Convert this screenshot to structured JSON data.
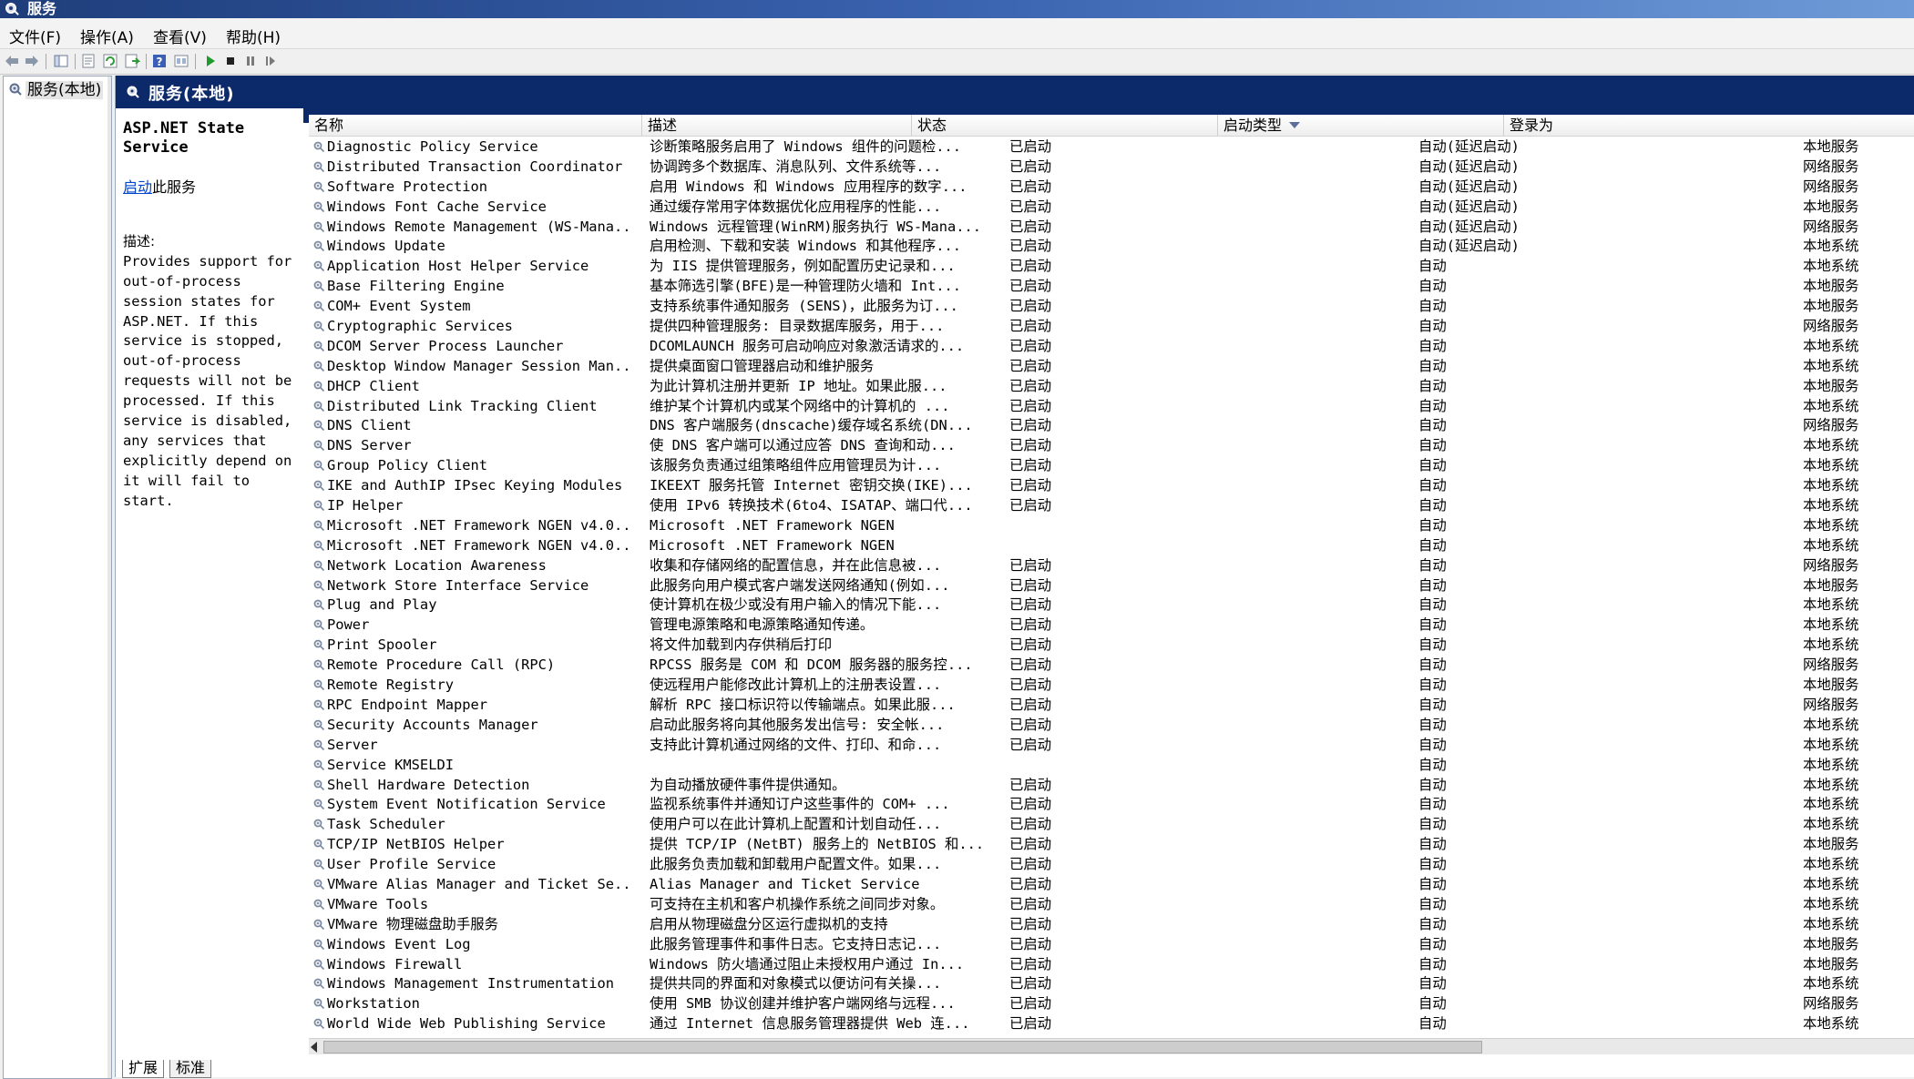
{
  "window": {
    "title": "服务",
    "icon": "gear-icon"
  },
  "menu": [
    "文件(F)",
    "操作(A)",
    "查看(V)",
    "帮助(H)"
  ],
  "toolbar": {
    "buttons": [
      "back-icon",
      "forward-icon",
      "show-hide-tree-icon",
      "properties-icon",
      "refresh-icon",
      "export-list-icon",
      "help-icon",
      "view-icon",
      "start-service-icon",
      "stop-service-icon",
      "pause-service-icon",
      "restart-service-icon"
    ]
  },
  "tree": {
    "root_label": "服务(本地)"
  },
  "pane": {
    "title": "服务(本地)"
  },
  "details": {
    "service_name": "ASP.NET State\nService",
    "action_link": "启动",
    "action_suffix": "此服务",
    "description_label": "描述:",
    "description_text": "Provides support for\nout-of-process\nsession states for\nASP.NET. If this\nservice is stopped,\nout-of-process\nrequests will not be\nprocessed. If this\nservice is disabled,\nany services that\nexplicitly depend on\nit will fail to start."
  },
  "columns": {
    "name": "名称",
    "description": "描述",
    "status": "状态",
    "startup_type": "启动类型",
    "logon_as": "登录为"
  },
  "services": [
    {
      "name": "Diagnostic Policy Service",
      "desc": "诊断策略服务启用了 Windows 组件的问题检...",
      "status": "已启动",
      "startup": "自动(延迟启动)",
      "logon": "本地服务"
    },
    {
      "name": "Distributed Transaction Coordinator",
      "desc": "协调跨多个数据库、消息队列、文件系统等...",
      "status": "已启动",
      "startup": "自动(延迟启动)",
      "logon": "网络服务"
    },
    {
      "name": "Software Protection",
      "desc": "启用 Windows 和 Windows 应用程序的数字...",
      "status": "已启动",
      "startup": "自动(延迟启动)",
      "logon": "网络服务"
    },
    {
      "name": "Windows Font Cache Service",
      "desc": "通过缓存常用字体数据优化应用程序的性能...",
      "status": "已启动",
      "startup": "自动(延迟启动)",
      "logon": "本地服务"
    },
    {
      "name": "Windows Remote Management (WS-Mana...",
      "desc": "Windows 远程管理(WinRM)服务执行 WS-Mana...",
      "status": "已启动",
      "startup": "自动(延迟启动)",
      "logon": "网络服务"
    },
    {
      "name": "Windows Update",
      "desc": "启用检测、下载和安装 Windows 和其他程序...",
      "status": "已启动",
      "startup": "自动(延迟启动)",
      "logon": "本地系统"
    },
    {
      "name": "Application Host Helper Service",
      "desc": "为 IIS 提供管理服务，例如配置历史记录和...",
      "status": "已启动",
      "startup": "自动",
      "logon": "本地系统"
    },
    {
      "name": "Base Filtering Engine",
      "desc": "基本筛选引擎(BFE)是一种管理防火墙和 Int...",
      "status": "已启动",
      "startup": "自动",
      "logon": "本地服务"
    },
    {
      "name": "COM+ Event System",
      "desc": "支持系统事件通知服务 (SENS)，此服务为订...",
      "status": "已启动",
      "startup": "自动",
      "logon": "本地服务"
    },
    {
      "name": "Cryptographic Services",
      "desc": "提供四种管理服务: 目录数据库服务，用于...",
      "status": "已启动",
      "startup": "自动",
      "logon": "网络服务"
    },
    {
      "name": "DCOM Server Process Launcher",
      "desc": "DCOMLAUNCH 服务可启动响应对象激活请求的...",
      "status": "已启动",
      "startup": "自动",
      "logon": "本地系统"
    },
    {
      "name": "Desktop Window Manager Session Man...",
      "desc": "提供桌面窗口管理器启动和维护服务",
      "status": "已启动",
      "startup": "自动",
      "logon": "本地系统"
    },
    {
      "name": "DHCP Client",
      "desc": "为此计算机注册并更新 IP 地址。如果此服...",
      "status": "已启动",
      "startup": "自动",
      "logon": "本地服务"
    },
    {
      "name": "Distributed Link Tracking Client",
      "desc": "维护某个计算机内或某个网络中的计算机的 ...",
      "status": "已启动",
      "startup": "自动",
      "logon": "本地系统"
    },
    {
      "name": "DNS Client",
      "desc": "DNS 客户端服务(dnscache)缓存域名系统(DN...",
      "status": "已启动",
      "startup": "自动",
      "logon": "网络服务"
    },
    {
      "name": "DNS Server",
      "desc": "使 DNS 客户端可以通过应答 DNS 查询和动...",
      "status": "已启动",
      "startup": "自动",
      "logon": "本地系统"
    },
    {
      "name": "Group Policy Client",
      "desc": "该服务负责通过组策略组件应用管理员为计...",
      "status": "已启动",
      "startup": "自动",
      "logon": "本地系统"
    },
    {
      "name": "IKE and AuthIP IPsec Keying Modules",
      "desc": "IKEEXT 服务托管 Internet 密钥交换(IKE)...",
      "status": "已启动",
      "startup": "自动",
      "logon": "本地系统"
    },
    {
      "name": "IP Helper",
      "desc": "使用 IPv6 转换技术(6to4、ISATAP、端口代...",
      "status": "已启动",
      "startup": "自动",
      "logon": "本地系统"
    },
    {
      "name": "Microsoft .NET Framework NGEN v4.0...",
      "desc": "Microsoft .NET Framework NGEN",
      "status": "",
      "startup": "自动",
      "logon": "本地系统"
    },
    {
      "name": "Microsoft .NET Framework NGEN v4.0...",
      "desc": "Microsoft .NET Framework NGEN",
      "status": "",
      "startup": "自动",
      "logon": "本地系统"
    },
    {
      "name": "Network Location Awareness",
      "desc": "收集和存储网络的配置信息，并在此信息被...",
      "status": "已启动",
      "startup": "自动",
      "logon": "网络服务"
    },
    {
      "name": "Network Store Interface Service",
      "desc": "此服务向用户模式客户端发送网络通知(例如...",
      "status": "已启动",
      "startup": "自动",
      "logon": "本地服务"
    },
    {
      "name": "Plug and Play",
      "desc": "使计算机在极少或没有用户输入的情况下能...",
      "status": "已启动",
      "startup": "自动",
      "logon": "本地系统"
    },
    {
      "name": "Power",
      "desc": "管理电源策略和电源策略通知传递。",
      "status": "已启动",
      "startup": "自动",
      "logon": "本地系统"
    },
    {
      "name": "Print Spooler",
      "desc": "将文件加载到内存供稍后打印",
      "status": "已启动",
      "startup": "自动",
      "logon": "本地系统"
    },
    {
      "name": "Remote Procedure Call (RPC)",
      "desc": "RPCSS 服务是 COM 和 DCOM 服务器的服务控...",
      "status": "已启动",
      "startup": "自动",
      "logon": "网络服务"
    },
    {
      "name": "Remote Registry",
      "desc": "使远程用户能修改此计算机上的注册表设置...",
      "status": "已启动",
      "startup": "自动",
      "logon": "本地服务"
    },
    {
      "name": "RPC Endpoint Mapper",
      "desc": "解析 RPC 接口标识符以传输端点。如果此服...",
      "status": "已启动",
      "startup": "自动",
      "logon": "网络服务"
    },
    {
      "name": "Security Accounts Manager",
      "desc": "启动此服务将向其他服务发出信号: 安全帐...",
      "status": "已启动",
      "startup": "自动",
      "logon": "本地系统"
    },
    {
      "name": "Server",
      "desc": "支持此计算机通过网络的文件、打印、和命...",
      "status": "已启动",
      "startup": "自动",
      "logon": "本地系统"
    },
    {
      "name": "Service KMSELDI",
      "desc": "",
      "status": "",
      "startup": "自动",
      "logon": "本地系统"
    },
    {
      "name": "Shell Hardware Detection",
      "desc": "为自动播放硬件事件提供通知。",
      "status": "已启动",
      "startup": "自动",
      "logon": "本地系统"
    },
    {
      "name": "System Event Notification Service",
      "desc": "监视系统事件并通知订户这些事件的 COM+ ...",
      "status": "已启动",
      "startup": "自动",
      "logon": "本地系统"
    },
    {
      "name": "Task Scheduler",
      "desc": "使用户可以在此计算机上配置和计划自动任...",
      "status": "已启动",
      "startup": "自动",
      "logon": "本地系统"
    },
    {
      "name": "TCP/IP NetBIOS Helper",
      "desc": "提供 TCP/IP (NetBT) 服务上的 NetBIOS 和...",
      "status": "已启动",
      "startup": "自动",
      "logon": "本地服务"
    },
    {
      "name": "User Profile Service",
      "desc": "此服务负责加载和卸载用户配置文件。如果...",
      "status": "已启动",
      "startup": "自动",
      "logon": "本地系统"
    },
    {
      "name": "VMware Alias Manager and Ticket Se...",
      "desc": "Alias Manager and Ticket Service",
      "status": "已启动",
      "startup": "自动",
      "logon": "本地系统"
    },
    {
      "name": "VMware Tools",
      "desc": "可支持在主机和客户机操作系统之间同步对象。",
      "status": "已启动",
      "startup": "自动",
      "logon": "本地系统"
    },
    {
      "name": "VMware 物理磁盘助手服务",
      "desc": "启用从物理磁盘分区运行虚拟机的支持",
      "status": "已启动",
      "startup": "自动",
      "logon": "本地系统"
    },
    {
      "name": "Windows Event Log",
      "desc": "此服务管理事件和事件日志。它支持日志记...",
      "status": "已启动",
      "startup": "自动",
      "logon": "本地服务"
    },
    {
      "name": "Windows Firewall",
      "desc": "Windows 防火墙通过阻止未授权用户通过 In...",
      "status": "已启动",
      "startup": "自动",
      "logon": "本地服务"
    },
    {
      "name": "Windows Management Instrumentation",
      "desc": "提供共同的界面和对象模式以便访问有关操...",
      "status": "已启动",
      "startup": "自动",
      "logon": "本地系统"
    },
    {
      "name": "Workstation",
      "desc": "使用 SMB 协议创建并维护客户端网络与远程...",
      "status": "已启动",
      "startup": "自动",
      "logon": "网络服务"
    },
    {
      "name": "World Wide Web Publishing Service",
      "desc": "通过 Internet 信息服务管理器提供 Web 连...",
      "status": "已启动",
      "startup": "自动",
      "logon": "本地系统"
    }
  ],
  "tabs": [
    "扩展",
    "标准"
  ],
  "colors": {
    "title_gradient_start": "#1e3d7a",
    "pane_header": "#0c2a6a",
    "link": "#0044cc"
  }
}
